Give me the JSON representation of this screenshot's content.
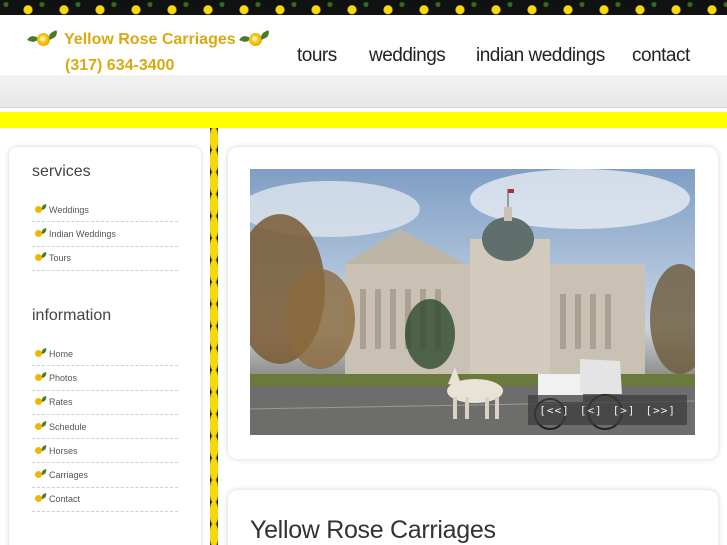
{
  "header": {
    "brand": "Yellow Rose Carriages",
    "phone": "(317) 634-3400"
  },
  "nav": {
    "items": [
      {
        "label": "tours"
      },
      {
        "label": "weddings"
      },
      {
        "label": "indian weddings"
      },
      {
        "label": "contact"
      }
    ]
  },
  "sidebar": {
    "services_heading": "services",
    "services": [
      {
        "label": "Weddings"
      },
      {
        "label": "Indian Weddings"
      },
      {
        "label": "Tours"
      }
    ],
    "information_heading": "information",
    "information": [
      {
        "label": "Home"
      },
      {
        "label": "Photos"
      },
      {
        "label": "Rates"
      },
      {
        "label": "Schedule"
      },
      {
        "label": "Horses"
      },
      {
        "label": "Carriages"
      },
      {
        "label": "Contact"
      }
    ]
  },
  "slideshow": {
    "controls": {
      "first": "[<<]",
      "prev": "[<]",
      "next": "[>]",
      "last": "[>>]"
    }
  },
  "content": {
    "title": "Yellow Rose Carriages"
  },
  "colors": {
    "brand_gold": "#d9aa10",
    "accent_yellow": "#ffff00",
    "nav_text": "#222222"
  }
}
